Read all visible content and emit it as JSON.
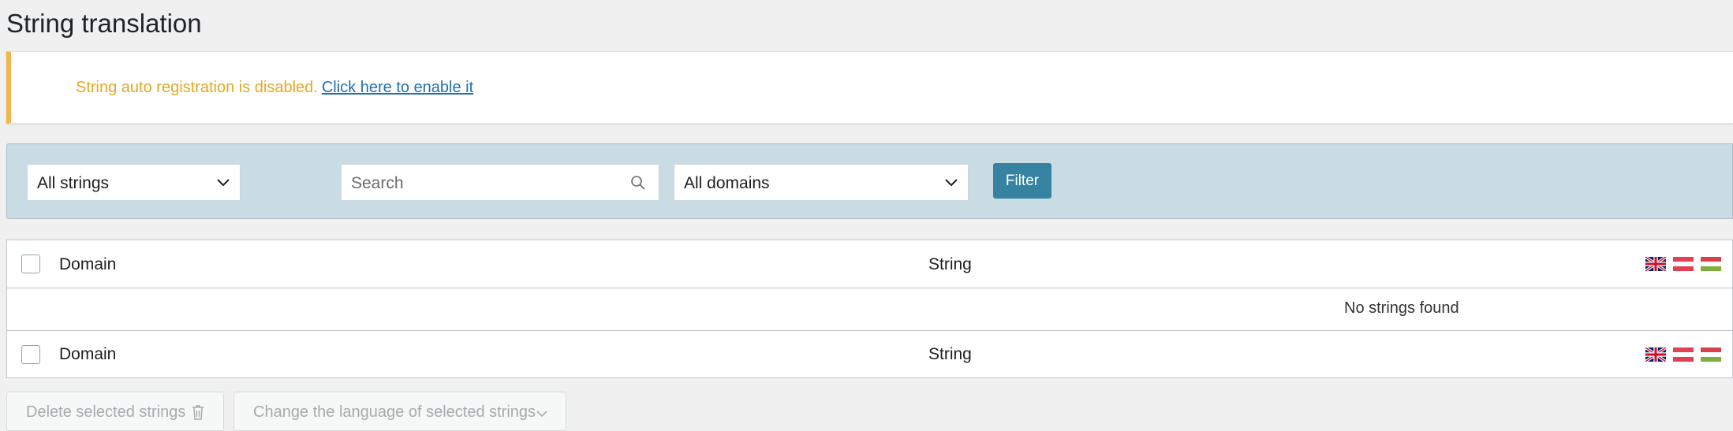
{
  "page": {
    "title": "String translation"
  },
  "notice": {
    "message": "String auto registration is disabled.",
    "link": "Click here to enable it"
  },
  "filters": {
    "strings_select": "All strings",
    "search_placeholder": "Search",
    "domains_select": "All domains",
    "filter_button": "Filter"
  },
  "table": {
    "columns": {
      "domain": "Domain",
      "string": "String"
    },
    "empty_message": "No strings found",
    "language_flags": [
      "uk-flag-icon",
      "austria-flag-icon",
      "hungary-flag-icon"
    ]
  },
  "bulk_actions": {
    "delete": "Delete selected strings",
    "change_language": "Change the language of selected strings"
  },
  "colors": {
    "notice_accent": "#f0b849",
    "notice_text": "#e5a823",
    "link": "#2271b1",
    "filter_bar": "#c9dbe3",
    "primary_button": "#3582a1"
  }
}
